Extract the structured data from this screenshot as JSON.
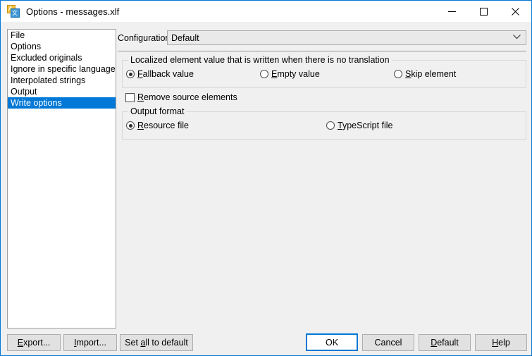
{
  "window": {
    "title": "Options - messages.xlf",
    "icon": "translation-file-icon",
    "controls": {
      "minimize": "minimize-icon",
      "maximize": "maximize-icon",
      "close": "close-icon"
    },
    "accent_color": "#0078d7",
    "background_color": "#f0f0f0"
  },
  "sidebar": {
    "items": [
      {
        "label": "File",
        "selected": false
      },
      {
        "label": "Options",
        "selected": false
      },
      {
        "label": "Excluded originals",
        "selected": false
      },
      {
        "label": "Ignore in specific languages",
        "selected": false
      },
      {
        "label": "Interpolated strings",
        "selected": false
      },
      {
        "label": "Output",
        "selected": false
      },
      {
        "label": "Write options",
        "selected": true
      }
    ],
    "selected_color": "#0078d7"
  },
  "configuration": {
    "label": "Configuration:",
    "value": "Default",
    "chevron": "chevron-down-icon"
  },
  "groups": [
    {
      "legend": "Localized element value that is written when there is no translation",
      "options": [
        {
          "label": "Fallback value",
          "mnemonic": "F",
          "checked": true
        },
        {
          "label": "Empty value",
          "mnemonic": "E",
          "checked": false
        },
        {
          "label": "Skip element",
          "mnemonic": "S",
          "checked": false
        }
      ]
    },
    {
      "legend": "Output format",
      "options": [
        {
          "label": "Resource file",
          "mnemonic": "R",
          "checked": true
        },
        {
          "label": "TypeScript file",
          "mnemonic": "T",
          "checked": false
        }
      ]
    }
  ],
  "checkbox": {
    "label": "Remove source elements",
    "mnemonic": "R",
    "checked": false
  },
  "buttons": {
    "export": {
      "label": "Export...",
      "mnemonic": "E"
    },
    "import": {
      "label": "Import...",
      "mnemonic": "I"
    },
    "set_all_to_default": {
      "label": "Set all to default",
      "mnemonic": "a"
    },
    "ok": {
      "label": "OK",
      "focused": true
    },
    "cancel": {
      "label": "Cancel"
    },
    "default": {
      "label": "Default",
      "mnemonic": "D"
    },
    "help": {
      "label": "Help",
      "mnemonic": "H"
    }
  }
}
